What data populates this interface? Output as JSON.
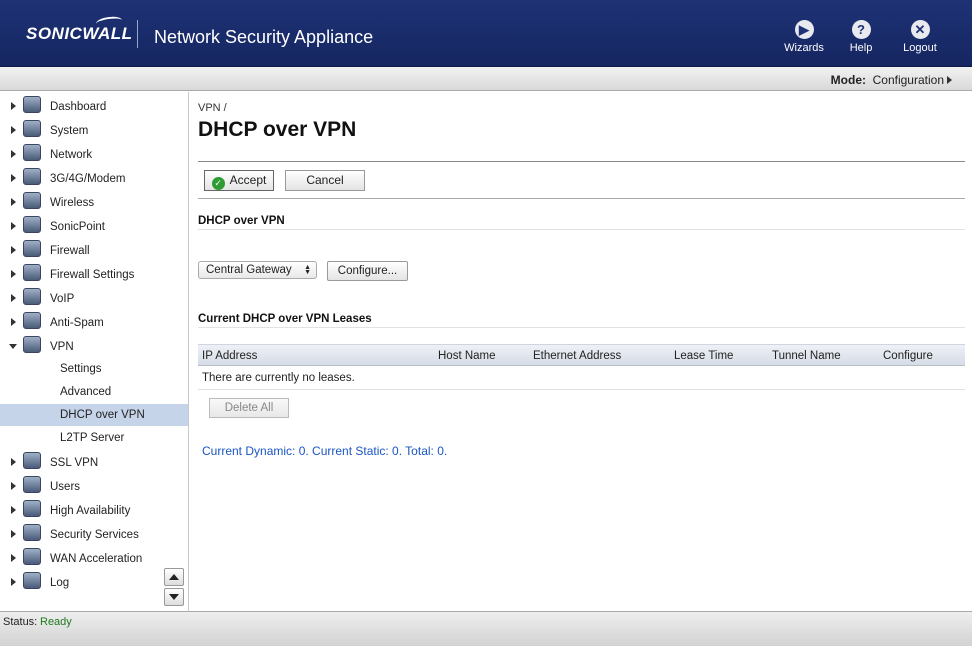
{
  "header": {
    "logo_text": "SONICWALL",
    "app_title": "Network Security Appliance",
    "buttons": [
      {
        "label": "Wizards",
        "icon": "wizards-icon"
      },
      {
        "label": "Help",
        "icon": "help-icon"
      },
      {
        "label": "Logout",
        "icon": "logout-icon"
      }
    ]
  },
  "modebar": {
    "label": "Mode:",
    "value": "Configuration"
  },
  "sidebar": {
    "items": [
      {
        "label": "Dashboard",
        "icon": "dashboard-icon"
      },
      {
        "label": "System",
        "icon": "system-icon"
      },
      {
        "label": "Network",
        "icon": "network-icon"
      },
      {
        "label": "3G/4G/Modem",
        "icon": "modem-icon"
      },
      {
        "label": "Wireless",
        "icon": "wireless-icon"
      },
      {
        "label": "SonicPoint",
        "icon": "sonicpoint-icon"
      },
      {
        "label": "Firewall",
        "icon": "firewall-icon"
      },
      {
        "label": "Firewall Settings",
        "icon": "firewall-settings-icon"
      },
      {
        "label": "VoIP",
        "icon": "voip-icon"
      },
      {
        "label": "Anti-Spam",
        "icon": "anti-spam-icon"
      },
      {
        "label": "VPN",
        "icon": "vpn-icon"
      }
    ],
    "vpn_sub": [
      "Settings",
      "Advanced",
      "DHCP over VPN",
      "L2TP Server"
    ],
    "items_after": [
      {
        "label": "SSL VPN",
        "icon": "ssl-vpn-icon"
      },
      {
        "label": "Users",
        "icon": "users-icon"
      },
      {
        "label": "High Availability",
        "icon": "high-availability-icon"
      },
      {
        "label": "Security Services",
        "icon": "security-services-icon"
      },
      {
        "label": "WAN Acceleration",
        "icon": "wan-acceleration-icon"
      },
      {
        "label": "Log",
        "icon": "log-icon"
      }
    ]
  },
  "main": {
    "breadcrumb": "VPN /",
    "title": "DHCP over VPN",
    "toolbar": {
      "accept": "Accept",
      "cancel": "Cancel"
    },
    "section1_title": "DHCP over VPN",
    "gateway_select": "Central Gateway",
    "configure_label": "Configure...",
    "section2_title": "Current DHCP over VPN Leases",
    "table": {
      "columns": [
        "IP Address",
        "Host Name",
        "Ethernet Address",
        "Lease Time",
        "Tunnel Name",
        "Configure"
      ],
      "empty_text": "There are currently no leases."
    },
    "delete_all": "Delete All",
    "summary": "Current Dynamic: 0. Current Static: 0. Total: 0.",
    "summary_color": "#1a55c4"
  },
  "status": {
    "label": "Status:",
    "value": "Ready",
    "value_color": "#1f7a1f"
  }
}
